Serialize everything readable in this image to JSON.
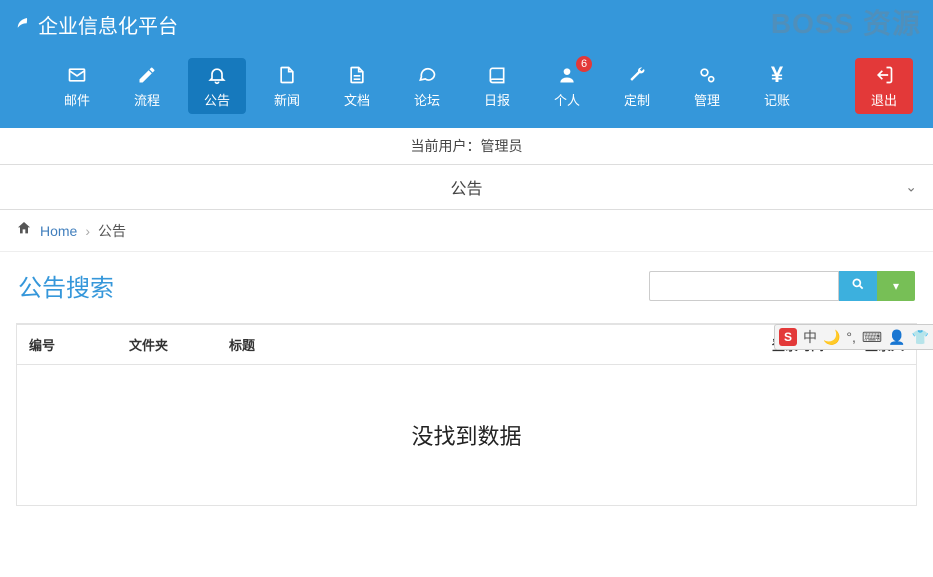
{
  "header": {
    "title": "企业信息化平台"
  },
  "watermark": "BOSS 资源",
  "nav": [
    {
      "key": "mail",
      "label": "邮件",
      "icon": "✉"
    },
    {
      "key": "flow",
      "label": "流程",
      "icon": "✎"
    },
    {
      "key": "notice",
      "label": "公告",
      "icon": "🔔",
      "active": true
    },
    {
      "key": "news",
      "label": "新闻",
      "icon": "📄"
    },
    {
      "key": "docs",
      "label": "文档",
      "icon": "📄"
    },
    {
      "key": "forum",
      "label": "论坛",
      "icon": "💬"
    },
    {
      "key": "daily",
      "label": "日报",
      "icon": "📕"
    },
    {
      "key": "profile",
      "label": "个人",
      "icon": "👤",
      "badge": "6"
    },
    {
      "key": "custom",
      "label": "定制",
      "icon": "🔧"
    },
    {
      "key": "manage",
      "label": "管理",
      "icon": "⚙"
    },
    {
      "key": "ledger",
      "label": "记账",
      "icon": "¥"
    },
    {
      "key": "logout",
      "label": "退出",
      "icon": "↪",
      "logout": true
    }
  ],
  "status": {
    "label": "当前用户：",
    "user": "管理员"
  },
  "collapser": {
    "title": "公告"
  },
  "breadcrumb": {
    "home": "Home",
    "current": "公告"
  },
  "search": {
    "title": "公告搜索",
    "value": ""
  },
  "table": {
    "columns": {
      "id": "编号",
      "folder": "文件夹",
      "title": "标题",
      "loginTime": "登录时间",
      "loginUser": "登录人"
    },
    "empty": "没找到数据"
  },
  "ime": {
    "s": "S",
    "lang": "中"
  }
}
